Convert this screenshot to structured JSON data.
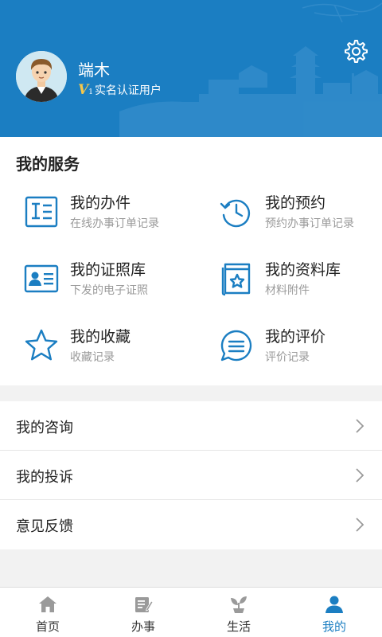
{
  "profile": {
    "name": "端木",
    "level_badge": "V",
    "level_num": "1",
    "verification": "实名认证用户"
  },
  "services": {
    "title": "我的服务",
    "items": [
      {
        "title": "我的办件",
        "subtitle": "在线办事订单记录",
        "icon": "document-list-icon"
      },
      {
        "title": "我的预约",
        "subtitle": "预约办事订单记录",
        "icon": "history-clock-icon"
      },
      {
        "title": "我的证照库",
        "subtitle": "下发的电子证照",
        "icon": "id-card-icon"
      },
      {
        "title": "我的资料库",
        "subtitle": "材料附件",
        "icon": "book-star-icon"
      },
      {
        "title": "我的收藏",
        "subtitle": "收藏记录",
        "icon": "star-icon"
      },
      {
        "title": "我的评价",
        "subtitle": "评价记录",
        "icon": "comment-icon"
      }
    ]
  },
  "menu": [
    {
      "label": "我的咨询"
    },
    {
      "label": "我的投诉"
    },
    {
      "label": "意见反馈"
    }
  ],
  "tabs": [
    {
      "label": "首页",
      "icon": "home-icon"
    },
    {
      "label": "办事",
      "icon": "task-icon"
    },
    {
      "label": "生活",
      "icon": "sprout-icon"
    },
    {
      "label": "我的",
      "icon": "person-icon",
      "active": true
    }
  ],
  "colors": {
    "primary": "#1b7ec2",
    "header": "#1b7ec2",
    "badge": "#f7c84a"
  }
}
